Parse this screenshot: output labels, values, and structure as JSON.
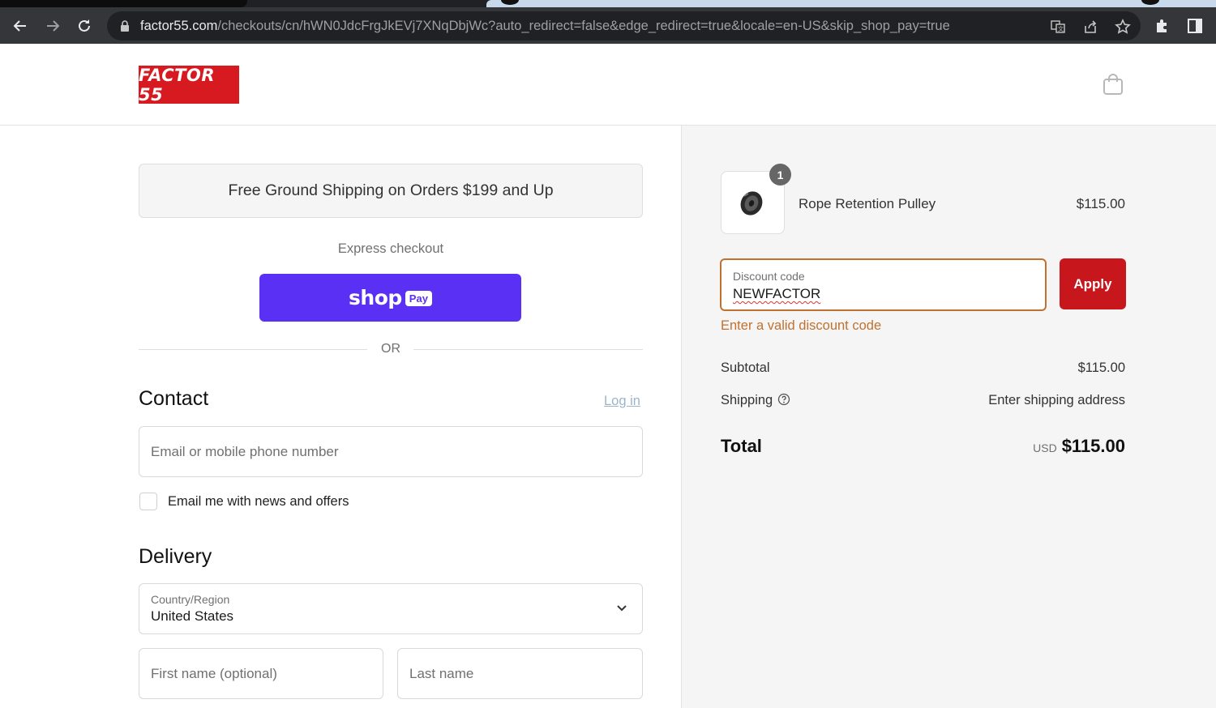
{
  "browser": {
    "url_host": "factor55.com",
    "url_path": "/checkouts/cn/hWN0JdcFrgJkEVj7XNqDbjWc?auto_redirect=false&edge_redirect=true&locale=en-US&skip_shop_pay=true"
  },
  "header": {
    "logo_text": "FACTOR 55"
  },
  "promo": {
    "text": "Free Ground Shipping on Orders $199 and Up"
  },
  "express": {
    "label": "Express checkout",
    "shop_text": "shop",
    "pay_text": "Pay",
    "or_text": "OR"
  },
  "contact": {
    "title": "Contact",
    "login_label": "Log in",
    "email_placeholder": "Email or mobile phone number",
    "newsletter_label": "Email me with news and offers"
  },
  "delivery": {
    "title": "Delivery",
    "country_label": "Country/Region",
    "country_value": "United States",
    "first_name_placeholder": "First name (optional)",
    "last_name_placeholder": "Last name"
  },
  "summary": {
    "item": {
      "quantity": "1",
      "name": "Rope Retention Pulley",
      "price": "$115.00"
    },
    "discount": {
      "label": "Discount code",
      "value": "NEWFACTOR",
      "apply_label": "Apply",
      "error": "Enter a valid discount code"
    },
    "subtotal_label": "Subtotal",
    "subtotal_value": "$115.00",
    "shipping_label": "Shipping",
    "shipping_value": "Enter shipping address",
    "total_label": "Total",
    "total_currency": "USD",
    "total_value": "$115.00"
  },
  "colors": {
    "brand_red": "#d71920",
    "shop_pay_purple": "#5a31f4",
    "apply_red": "#c8161d",
    "error_orange": "#c0712f"
  }
}
